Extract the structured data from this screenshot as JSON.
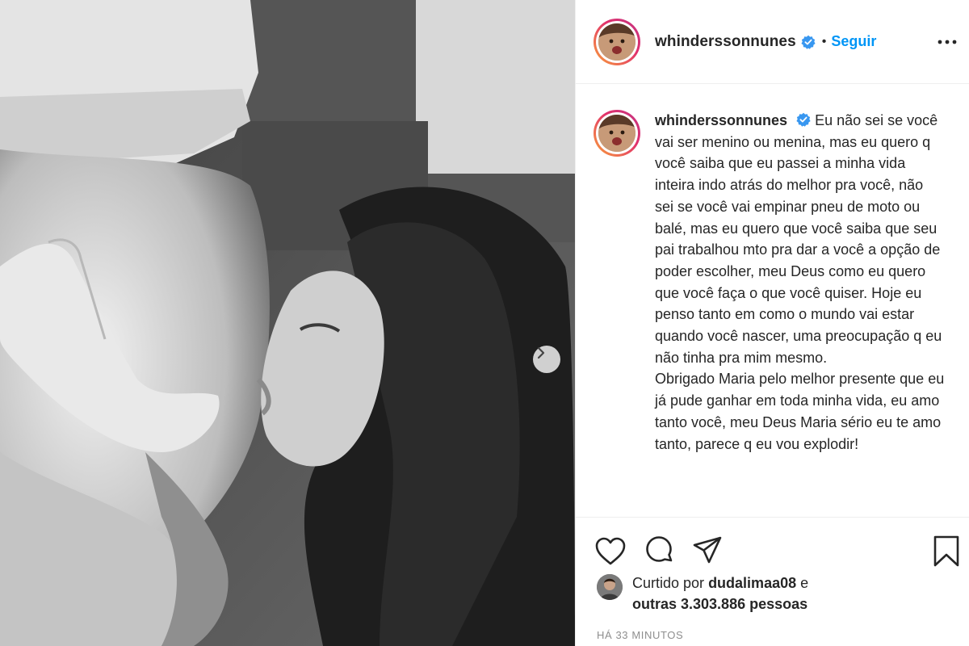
{
  "post": {
    "username": "whinderssonnunes",
    "follow_label": "Seguir",
    "separator": "•",
    "caption_user": "whinderssonnunes",
    "caption_body": "Eu não sei se você vai ser menino ou menina, mas eu quero q você saiba que eu passei a minha vida inteira indo atrás do melhor pra você, não sei se você vai empinar pneu de moto ou balé, mas eu quero que você saiba que seu pai trabalhou mto pra dar a você a opção de poder escolher, meu Deus como eu quero que você faça o que você quiser. Hoje eu penso tanto em como o mundo vai estar quando você nascer, uma preocupação q eu não tinha pra mim mesmo.\nObrigado Maria pelo melhor presente que eu já pude ganhar em toda minha vida, eu amo tanto você, meu Deus Maria sério eu te amo tanto, parece q eu vou explodir!",
    "likes_prefix": "Curtido por",
    "liker": "dudalimaa08",
    "likes_connector": "e",
    "likes_others": "outras 3.303.886 pessoas",
    "timestamp": "HÁ 33 MINUTOS"
  },
  "icons": {
    "verified": "verified-badge-icon",
    "more": "more-options-icon",
    "like": "heart-icon",
    "comment": "comment-icon",
    "share": "paper-plane-icon",
    "save": "bookmark-icon",
    "next": "chevron-right-icon"
  },
  "colors": {
    "accent": "#0095f6",
    "verified": "#3897f0",
    "text": "#262626",
    "muted": "#8e8e8e",
    "border": "#efefef"
  }
}
